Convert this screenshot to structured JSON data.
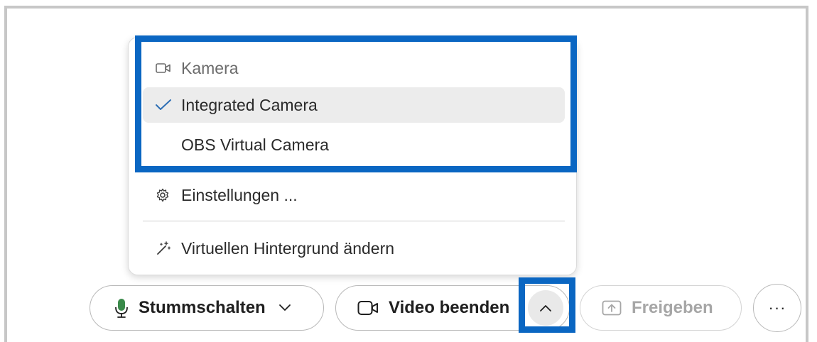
{
  "menu": {
    "header_label": "Kamera",
    "items": [
      {
        "label": "Integrated Camera",
        "selected": true
      },
      {
        "label": "OBS Virtual Camera",
        "selected": false
      }
    ],
    "settings_label": "Einstellungen ...",
    "background_label": "Virtuellen Hintergrund ändern"
  },
  "toolbar": {
    "mute_label": "Stummschalten",
    "video_label": "Video beenden",
    "share_label": "Freigeben",
    "more_label": "···"
  },
  "icons": {
    "header": "camera-icon",
    "selected": "checkmark-icon",
    "settings": "gear-icon",
    "background": "magic-wand-icon",
    "mute": "microphone-icon",
    "mute_chevron": "chevron-down-icon",
    "video": "camera-icon",
    "video_caret": "chevron-up-icon",
    "share": "share-upload-icon",
    "more": "more-dots-icon"
  },
  "colors": {
    "highlight": "#0a66c2",
    "checkmark": "#2e6fb5",
    "mic": "#3a8a4a",
    "disabled_text": "#a6a6a6"
  }
}
